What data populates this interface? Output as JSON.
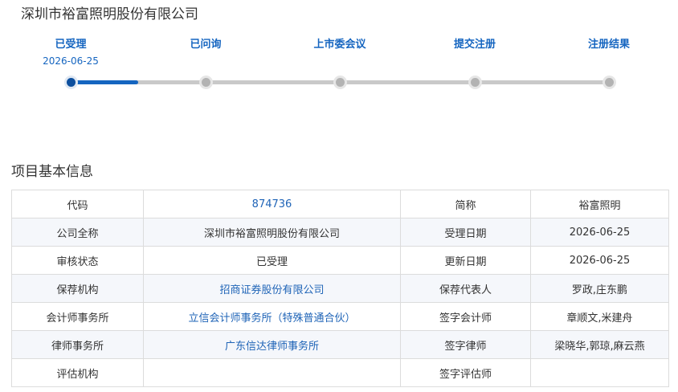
{
  "company": {
    "title": "深圳市裕富照明股份有限公司"
  },
  "progress": {
    "steps": [
      {
        "label": "已受理",
        "date": "2026-06-25",
        "active": true
      },
      {
        "label": "已问询",
        "date": "",
        "active": false
      },
      {
        "label": "上市委会议",
        "date": "",
        "active": false
      },
      {
        "label": "提交注册",
        "date": "",
        "active": false
      },
      {
        "label": "注册结果",
        "date": "",
        "active": false
      }
    ],
    "accent_color": "#1565c0",
    "inactive_color": "#c9c9c9"
  },
  "section": {
    "title": "项目基本信息"
  },
  "info": {
    "rows": [
      {
        "label1": "代码",
        "value1": "874736",
        "label2": "简称",
        "value2": "裕富照明"
      },
      {
        "label1": "公司全称",
        "value1": "深圳市裕富照明股份有限公司",
        "label2": "受理日期",
        "value2": "2026-06-25"
      },
      {
        "label1": "审核状态",
        "value1": "已受理",
        "label2": "更新日期",
        "value2": "2026-06-25"
      },
      {
        "label1": "保荐机构",
        "value1": "招商证券股份有限公司",
        "label2": "保荐代表人",
        "value2": "罗政,庄东鹏"
      },
      {
        "label1": "会计师事务所",
        "value1": "立信会计师事务所（特殊普通合伙）",
        "label2": "签字会计师",
        "value2": "章顺文,米建舟"
      },
      {
        "label1": "律师事务所",
        "value1": "广东信达律师事务所",
        "label2": "签字律师",
        "value2": "梁晓华,郭琼,麻云燕"
      },
      {
        "label1": "评估机构",
        "value1": "",
        "label2": "签字评估师",
        "value2": ""
      }
    ]
  }
}
